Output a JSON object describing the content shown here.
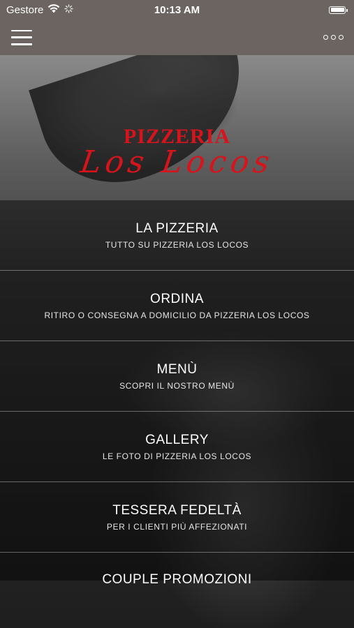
{
  "status": {
    "carrier": "Gestore",
    "time": "10:13 AM",
    "icons": [
      "wifi-icon",
      "activity-spinner-icon",
      "battery-icon"
    ]
  },
  "navbar": {
    "menu_icon": "hamburger-icon",
    "more_icon": "more-dots-icon"
  },
  "logo": {
    "line1": "PIZZERIA",
    "line2": "Los Locos"
  },
  "menu": {
    "items": [
      {
        "title": "LA PIZZERIA",
        "subtitle": "TUTTO SU PIZZERIA LOS LOCOS"
      },
      {
        "title": "ORDINA",
        "subtitle": "RITIRO O CONSEGNA A DOMICILIO DA PIZZERIA LOS LOCOS"
      },
      {
        "title": "MENÙ",
        "subtitle": "SCOPRI IL NOSTRO MENÙ"
      },
      {
        "title": "GALLERY",
        "subtitle": "LE FOTO DI PIZZERIA LOS LOCOS"
      },
      {
        "title": "TESSERA FEDELTÀ",
        "subtitle": "PER I CLIENTI PIÙ AFFEZIONATI"
      },
      {
        "title": "COUPLE PROMOZIONI",
        "subtitle": ""
      }
    ]
  },
  "colors": {
    "bar_background": "#6b6460",
    "logo_red": "#d7141c"
  }
}
